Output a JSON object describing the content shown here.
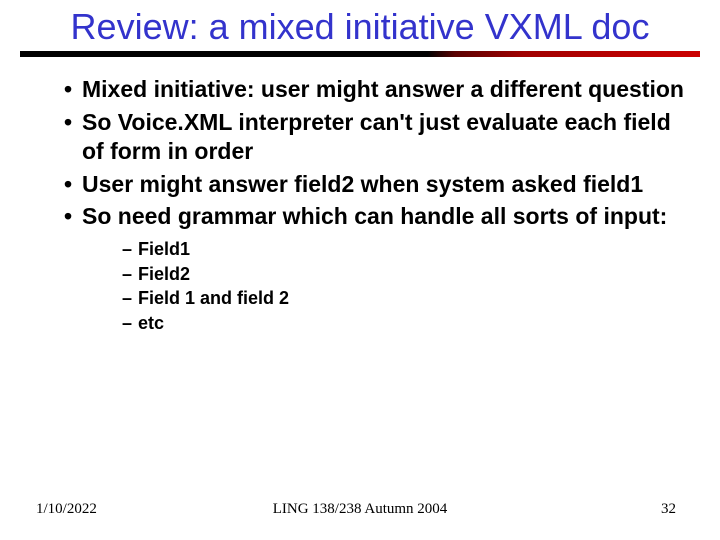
{
  "title": "Review: a mixed initiative VXML doc",
  "bullets": [
    "Mixed initiative: user might answer a different question",
    "So Voice.XML interpreter can't just evaluate each field of form in order",
    "User might answer field2 when system asked field1",
    "So need grammar which can handle all sorts of input:"
  ],
  "subbullets": [
    "Field1",
    "Field2",
    "Field 1 and field 2",
    "etc"
  ],
  "footer": {
    "date": "1/10/2022",
    "course": "LING 138/238 Autumn 2004",
    "page": "32"
  }
}
